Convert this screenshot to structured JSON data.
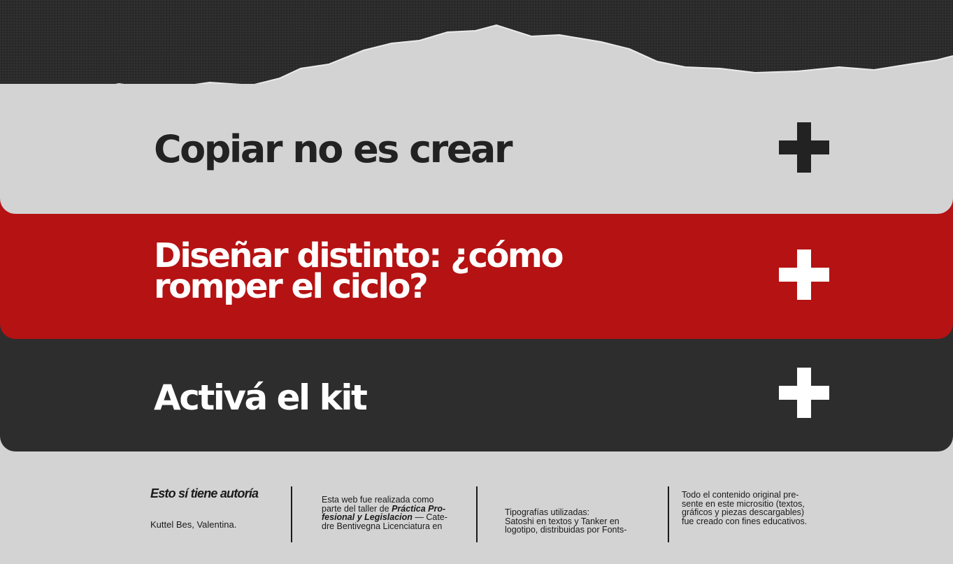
{
  "accordion": {
    "items": [
      {
        "title": "Copiar no es crear",
        "expanded": false,
        "toggle_icon": "plus-icon"
      },
      {
        "title": "Diseñar distinto: ¿cómo romper el ciclo?",
        "expanded": false,
        "toggle_icon": "plus-icon"
      },
      {
        "title": "Activá el kit",
        "expanded": false,
        "toggle_icon": "plus-icon"
      }
    ]
  },
  "footer": {
    "heading": "Esto sí tiene autoría",
    "author": "Kuttel Bes, Valentina.",
    "col2": {
      "line1": "Esta web fue realizada como",
      "line2_pre": "parte del taller de ",
      "line2_em": "Práctica Pro-",
      "line3_em": "fesional y Legislacion",
      "line3_post": " — Cate-",
      "line4": "dre Bentivegna Licenciatura en"
    },
    "col3": {
      "line1": "Tipografías utilizadas:",
      "line2": "Satoshi en textos y Tanker en",
      "line3": "logotipo, distribuidas por Fonts-"
    },
    "col4": {
      "line1": "Todo el contenido original pre-",
      "line2": "sente en este micrositio (textos,",
      "line3": "gráficos y piezas descargables)",
      "line4": "fue creado con fines educativos."
    }
  },
  "colors": {
    "page_bg": "#d3d3d3",
    "red_panel": "#b51213",
    "dark_panel": "#2d2d2d",
    "texture": "#2a2a2a"
  }
}
